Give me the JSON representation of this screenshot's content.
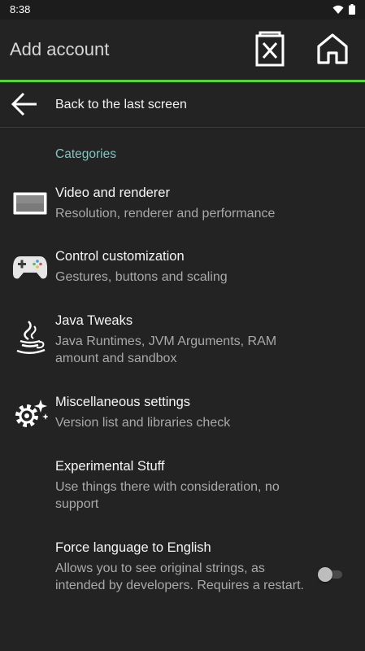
{
  "status_bar": {
    "time": "8:38"
  },
  "app_bar": {
    "title": "Add account",
    "delete_icon": "delete-icon",
    "home_icon": "home-icon"
  },
  "back": {
    "label": "Back to the last screen",
    "icon": "arrow-left-icon"
  },
  "category": {
    "title": "Categories"
  },
  "items": [
    {
      "title": "Video and renderer",
      "subtitle": "Resolution, renderer and performance",
      "icon": "display-icon"
    },
    {
      "title": "Control customization",
      "subtitle": "Gestures, buttons and scaling",
      "icon": "gamepad-icon"
    },
    {
      "title": "Java Tweaks",
      "subtitle": "Java Runtimes, JVM Arguments, RAM amount and sandbox",
      "icon": "java-icon"
    },
    {
      "title": "Miscellaneous settings",
      "subtitle": "Version list and libraries check",
      "icon": "gear-icon"
    },
    {
      "title": "Experimental Stuff",
      "subtitle": "Use things there with consideration, no support",
      "icon": ""
    },
    {
      "title": "Force language to English",
      "subtitle": "Allows you to see original strings, as intended by developers. Requires a restart.",
      "icon": "",
      "toggle": false
    }
  ],
  "colors": {
    "accent": "#57d63a",
    "category": "#7fc7c2",
    "background": "#232323"
  }
}
